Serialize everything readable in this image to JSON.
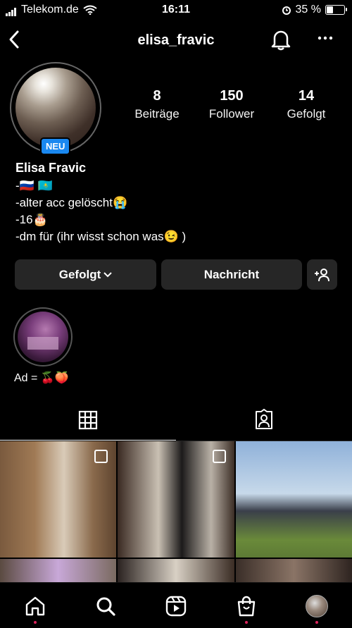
{
  "status_bar": {
    "carrier": "Telekom.de",
    "time": "16:11",
    "battery_percent": "35 %",
    "battery_level": 0.35
  },
  "header": {
    "username": "elisa_fravic",
    "back_icon": "chevron-left-icon",
    "bell_icon": "bell-icon",
    "more_icon": "more-horizontal-icon"
  },
  "profile": {
    "new_badge": "NEU",
    "stats": [
      {
        "value": "8",
        "label": "Beiträge"
      },
      {
        "value": "150",
        "label": "Follower"
      },
      {
        "value": "14",
        "label": "Gefolgt"
      }
    ],
    "name": "Elisa Fravic",
    "bio_lines": [
      "-🇷🇺 🇰🇿",
      "-alter acc gelöscht😭",
      "-16🎂",
      "-dm für (ihr wisst schon was😉 )"
    ]
  },
  "actions": {
    "following_label": "Gefolgt",
    "message_label": "Nachricht",
    "add_person_icon": "add-person-icon"
  },
  "highlights": [
    {
      "label": "Ad = 🍒🍑"
    }
  ],
  "tabs": [
    {
      "name": "posts-grid",
      "icon": "grid-icon",
      "active": true
    },
    {
      "name": "tagged",
      "icon": "tagged-person-icon",
      "active": false
    }
  ],
  "colors": {
    "background": "#000000",
    "button_bg": "#262626",
    "badge_blue": "#1a88f0",
    "notification_dot": "#e0245e"
  },
  "bottom_nav": [
    "home-icon",
    "search-icon",
    "reels-icon",
    "shop-icon",
    "profile-avatar"
  ]
}
